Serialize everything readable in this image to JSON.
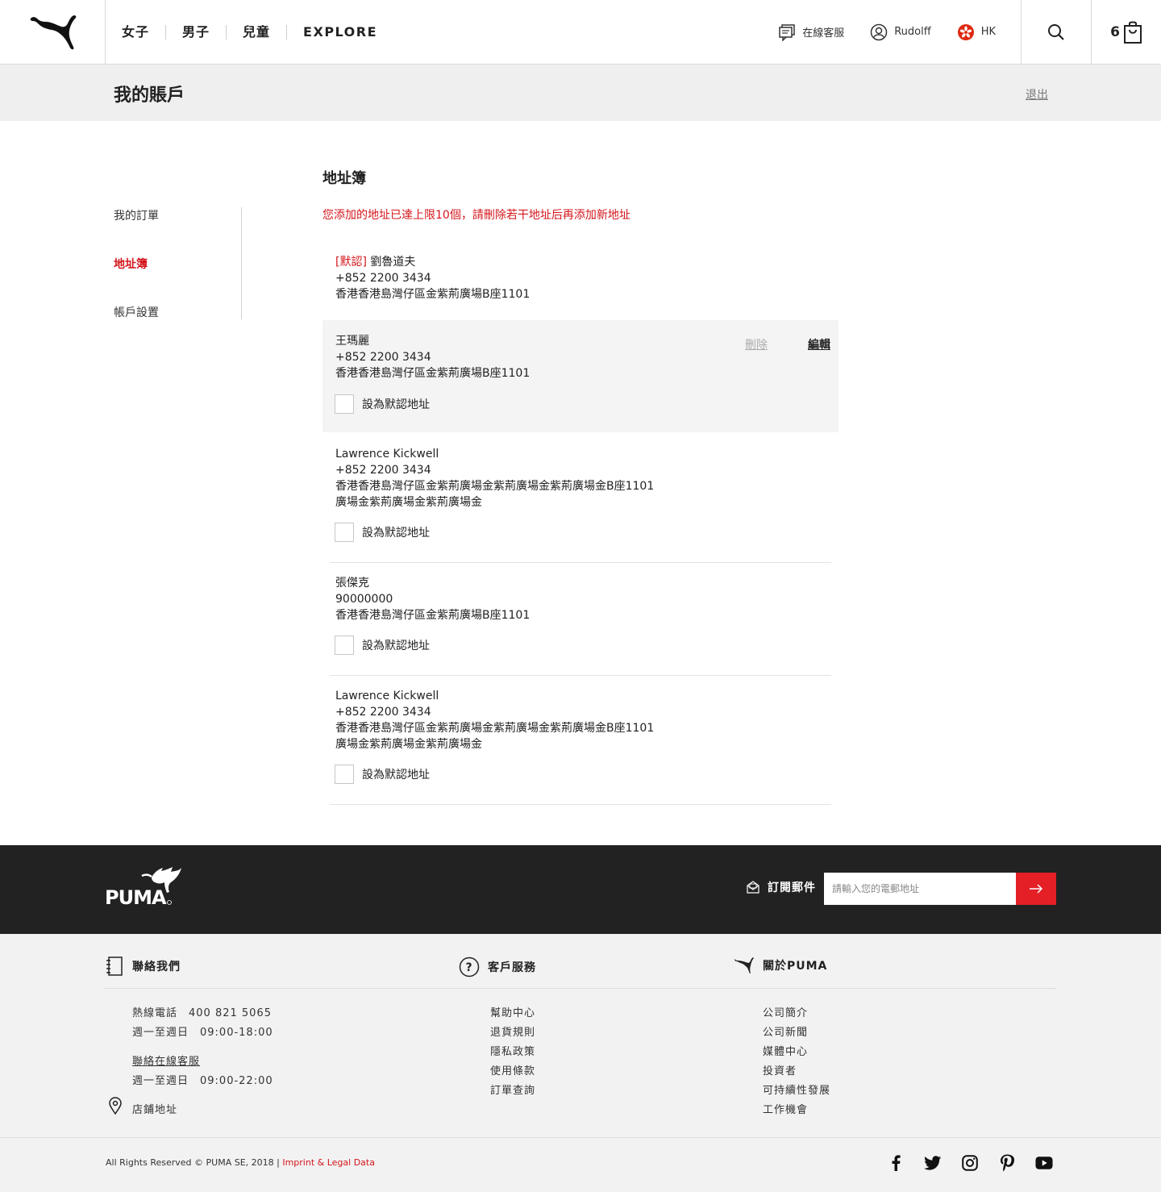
{
  "header": {
    "nav": [
      "女子",
      "男子",
      "兒童",
      "EXPLORE"
    ],
    "support_label": "在線客服",
    "user_name": "Rudolff",
    "region": "HK",
    "cart_count": "6"
  },
  "titlebar": {
    "title": "我的賬戶",
    "logout": "退出"
  },
  "sidebar": {
    "items": [
      {
        "label": "我的訂單",
        "active": false
      },
      {
        "label": "地址簿",
        "active": true
      },
      {
        "label": "帳戶設置",
        "active": false
      }
    ]
  },
  "main": {
    "section_title": "地址簿",
    "limit_message": "您添加的地址已達上限10個，請刪除若干地址后再添加新地址",
    "default_tag": "[默認]",
    "set_default_label": "設為默認地址",
    "delete_label": "刪除",
    "edit_label": "編輯",
    "addresses": [
      {
        "name": "劉魯道夫",
        "phone": "+852 2200 3434",
        "lines": [
          "香港香港島灣仔區金紫荊廣場B座1101"
        ],
        "is_default": true
      },
      {
        "name": "王瑪麗",
        "phone": "+852 2200 3434",
        "lines": [
          "香港香港島灣仔區金紫荊廣場B座1101"
        ],
        "is_default": false
      },
      {
        "name": "Lawrence Kickwell",
        "phone": "+852 2200 3434",
        "lines": [
          "香港香港島灣仔區金紫荊廣場金紫荊廣場金紫荊廣場金B座1101",
          "廣場金紫荊廣場金紫荊廣場金"
        ],
        "is_default": false
      },
      {
        "name": "張傑克",
        "phone": "90000000",
        "lines": [
          "香港香港島灣仔區金紫荊廣場B座1101"
        ],
        "is_default": false
      },
      {
        "name": "Lawrence Kickwell",
        "phone": "+852 2200 3434",
        "lines": [
          "香港香港島灣仔區金紫荊廣場金紫荊廣場金紫荊廣場金B座1101",
          "廣場金紫荊廣場金紫荊廣場金"
        ],
        "is_default": false
      }
    ]
  },
  "footer": {
    "subscribe_label": "訂閱郵件",
    "email_placeholder": "請輸入您的電郵地址",
    "contact": {
      "title": "聯絡我們",
      "hotline": "熱線電話　400 821 5065",
      "hotline_hours": "週一至週日　09:00-18:00",
      "online_service": "聯絡在線客服",
      "online_hours": "週一至週日　09:00-22:00",
      "store_address": "店鋪地址"
    },
    "service": {
      "title": "客戶服務",
      "items": [
        "幫助中心",
        "退貨規則",
        "隱私政策",
        "使用條款",
        "訂單查詢"
      ]
    },
    "about": {
      "title": "關於PUMA",
      "items": [
        "公司簡介",
        "公司新聞",
        "媒體中心",
        "投資者",
        "可持續性發展",
        "工作機會"
      ]
    },
    "copyright": "All Rights Reserved © PUMA SE, 2018 | ",
    "legal_link": "Imprint & Legal Data",
    "socials": [
      "facebook-icon",
      "twitter-icon",
      "instagram-icon",
      "pinterest-icon",
      "youtube-icon"
    ]
  }
}
